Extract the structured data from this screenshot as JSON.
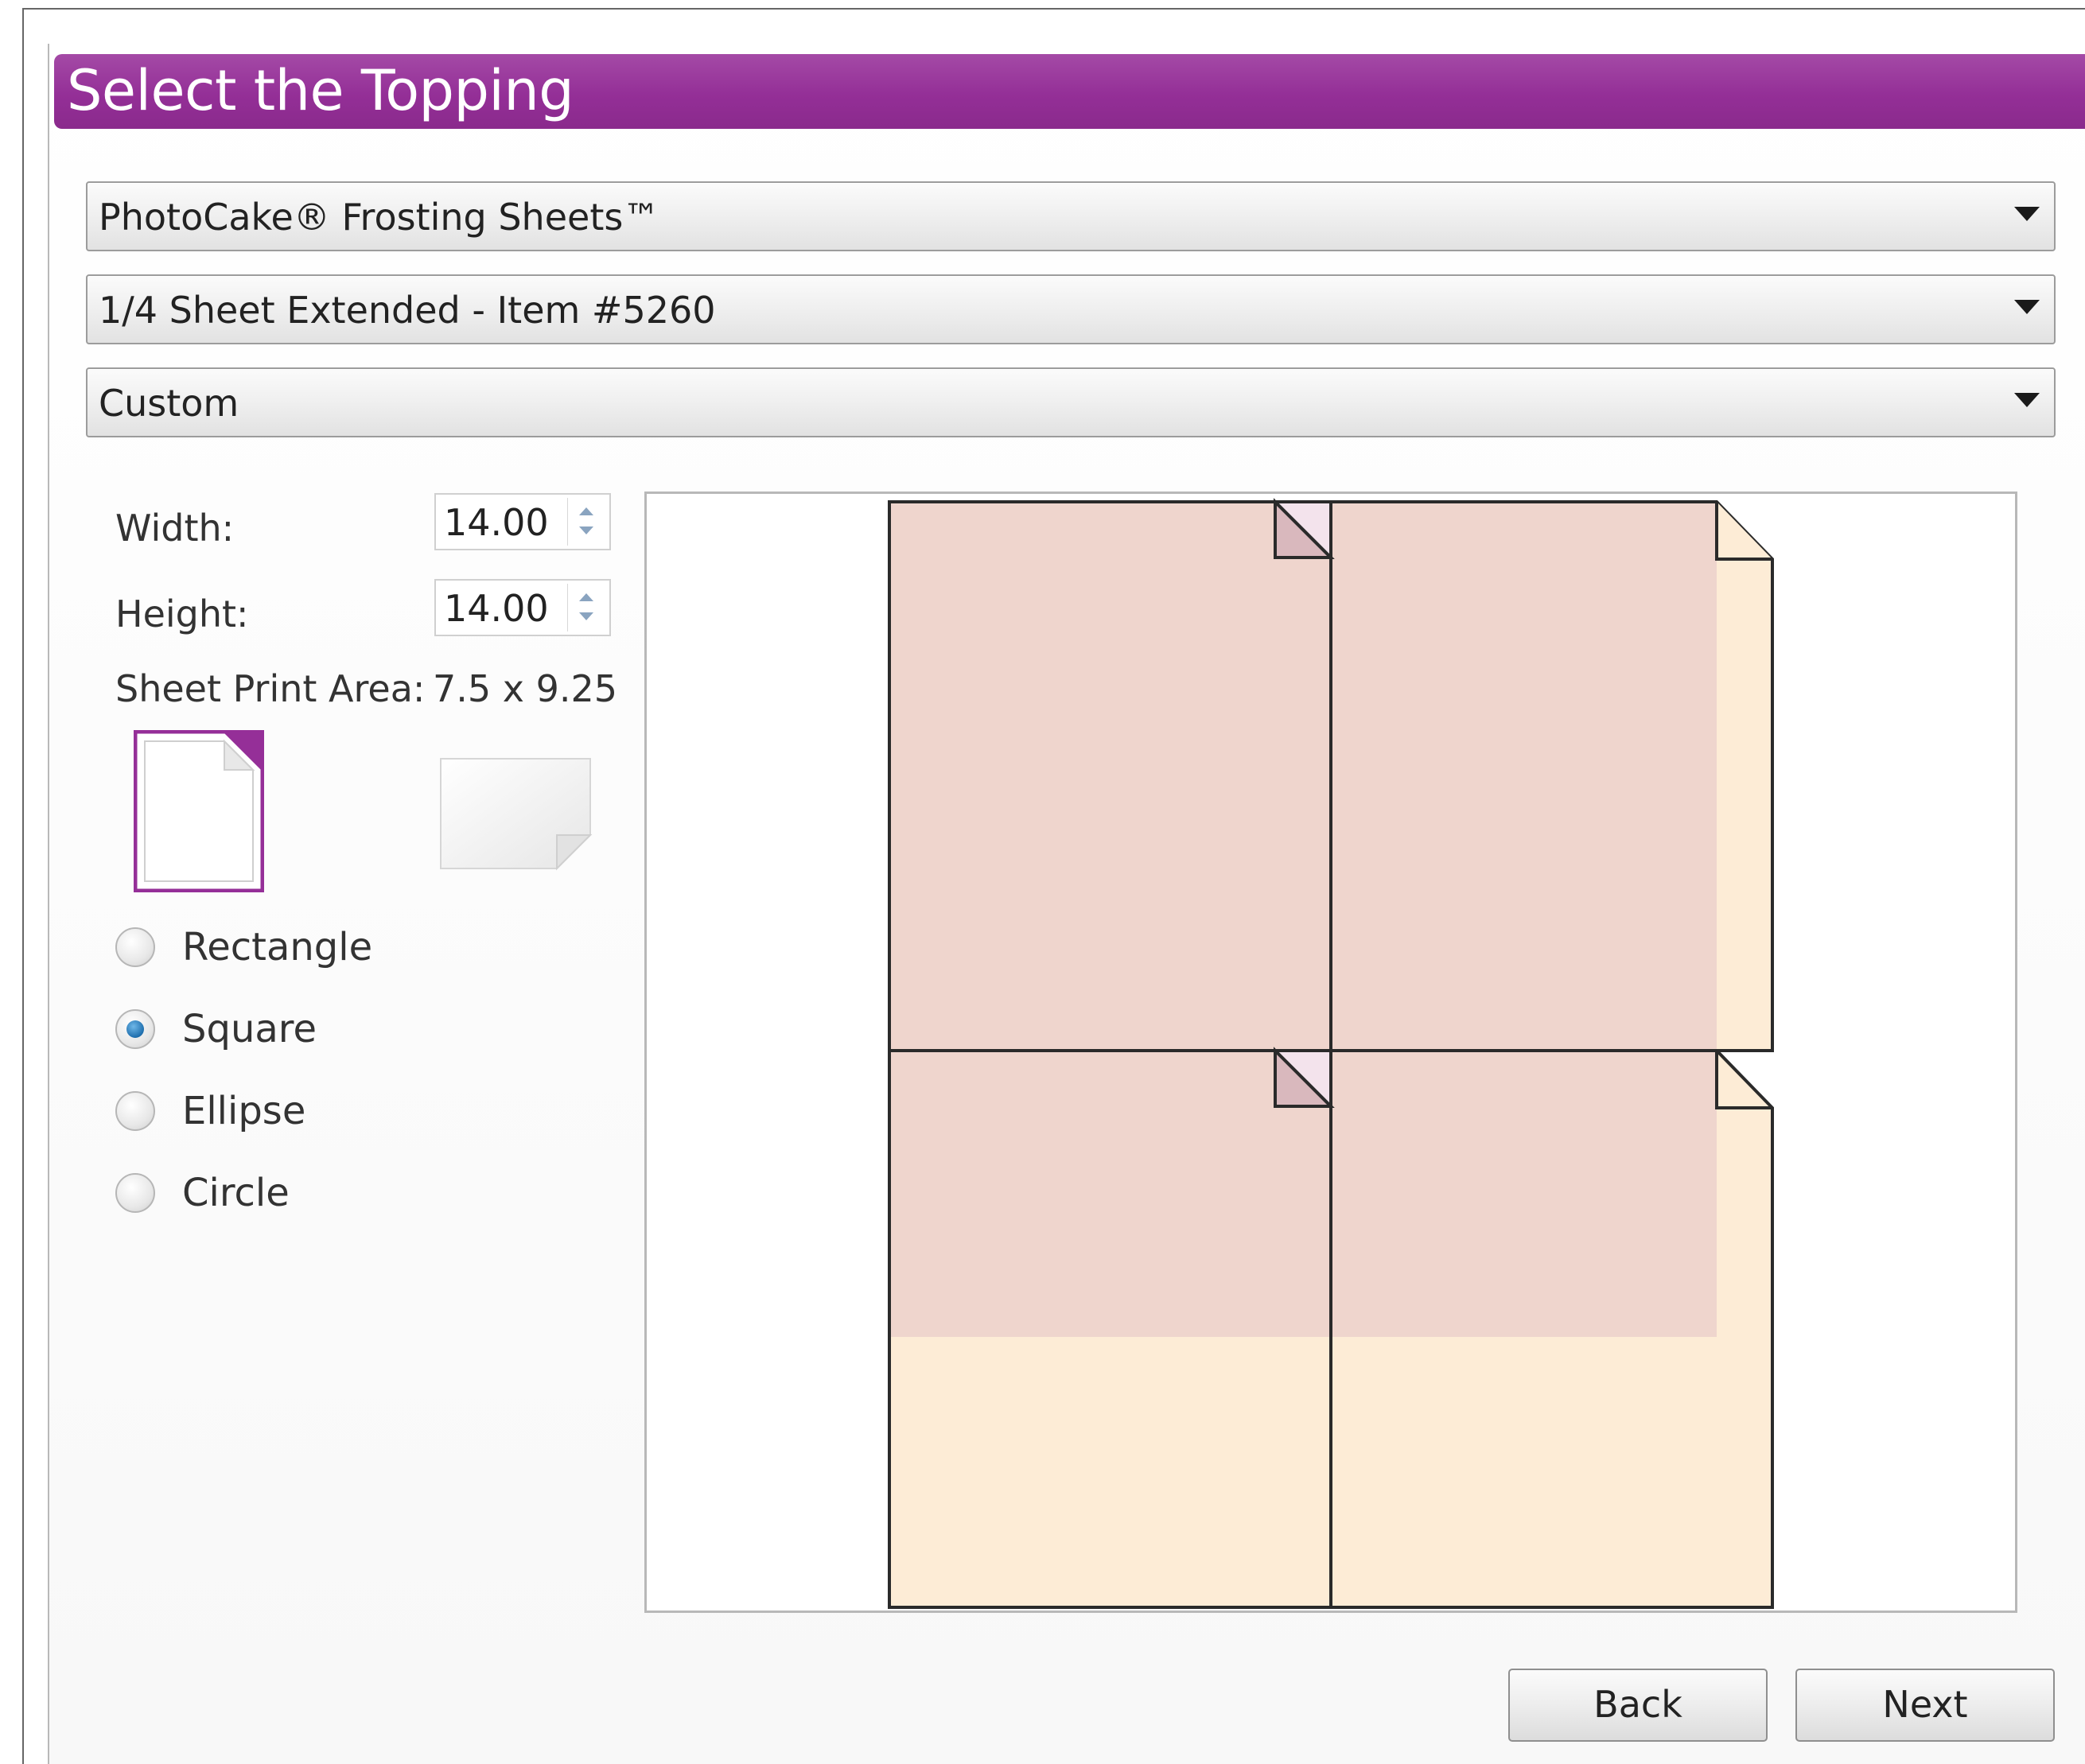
{
  "title": "Select the Topping",
  "dropdowns": {
    "product": "PhotoCake® Frosting Sheets™",
    "sheet": "1/4 Sheet Extended - Item #5260",
    "template": "Custom"
  },
  "fields": {
    "width_label": "Width:",
    "width_value": "14.00",
    "height_label": "Height:",
    "height_value": "14.00",
    "print_area_label": "Sheet Print Area:",
    "print_area_value": "7.5 x 9.25"
  },
  "shapes": [
    {
      "label": "Rectangle",
      "checked": false
    },
    {
      "label": "Square",
      "checked": true
    },
    {
      "label": "Ellipse",
      "checked": false
    },
    {
      "label": "Circle",
      "checked": false
    }
  ],
  "orientation": {
    "portrait_selected": true,
    "landscape_selected": false
  },
  "buttons": {
    "back": "Back",
    "next": "Next"
  },
  "colors": {
    "accent": "#952f98",
    "sheet_fill": "#fdecd6",
    "overlay_fill": "#e8c8c4"
  }
}
